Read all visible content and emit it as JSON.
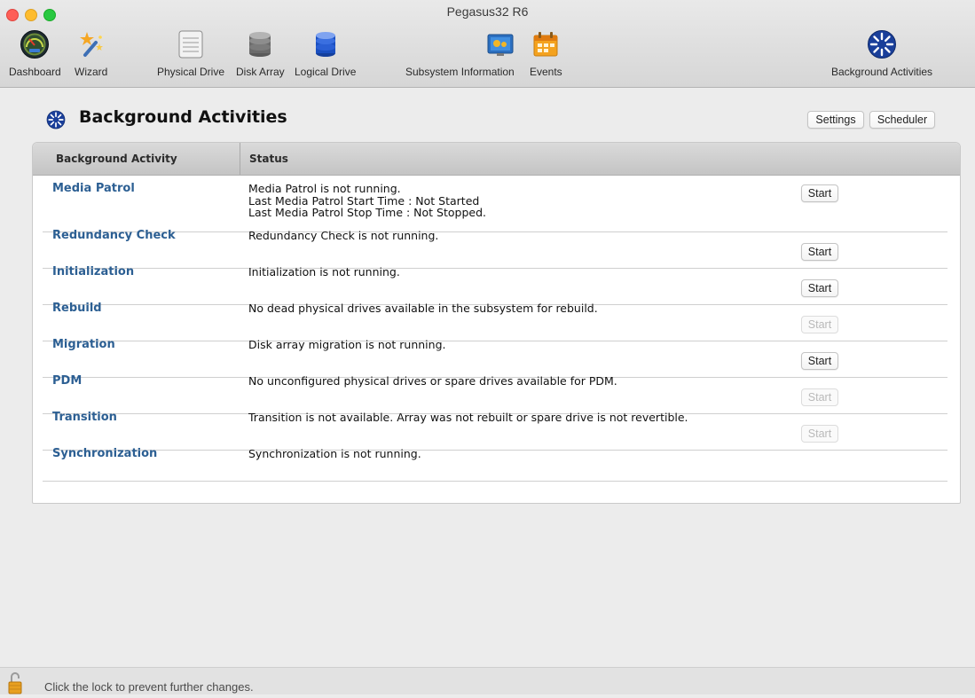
{
  "window": {
    "title": "Pegasus32 R6"
  },
  "toolbar": {
    "items": [
      {
        "label": "Dashboard",
        "icon": "dashboard-gauge-icon"
      },
      {
        "label": "Wizard",
        "icon": "wizard-wand-icon"
      },
      {
        "label": "Physical Drive",
        "icon": "physical-drive-icon"
      },
      {
        "label": "Disk Array",
        "icon": "disk-array-icon"
      },
      {
        "label": "Logical Drive",
        "icon": "logical-drive-icon"
      },
      {
        "label": "Subsystem Information",
        "icon": "subsystem-information-icon"
      },
      {
        "label": "Events",
        "icon": "events-calendar-icon"
      },
      {
        "label": "Background Activities",
        "icon": "background-activities-icon"
      }
    ]
  },
  "main": {
    "title": "Background Activities",
    "settings_label": "Settings",
    "scheduler_label": "Scheduler",
    "columns": [
      "Background Activity",
      "Status"
    ],
    "activities": [
      {
        "name": "Media Patrol",
        "status": [
          "Media Patrol is not running.",
          "Last Media Patrol Start Time : Not Started",
          "Last Media Patrol Stop Time : Not Stopped."
        ],
        "button": "Start",
        "enabled": true
      },
      {
        "name": "Redundancy Check",
        "status": [
          "Redundancy Check is not running."
        ],
        "button": "Start",
        "enabled": true
      },
      {
        "name": "Initialization",
        "status": [
          "Initialization is not running."
        ],
        "button": "Start",
        "enabled": true
      },
      {
        "name": "Rebuild",
        "status": [
          "No dead physical drives available in the subsystem for rebuild."
        ],
        "button": "Start",
        "enabled": false
      },
      {
        "name": "Migration",
        "status": [
          "Disk array migration is not running."
        ],
        "button": "Start",
        "enabled": true
      },
      {
        "name": "PDM",
        "status": [
          "No unconfigured physical drives or spare drives available for PDM."
        ],
        "button": "Start",
        "enabled": false
      },
      {
        "name": "Transition",
        "status": [
          "Transition is not available. Array was not rebuilt or spare drive is not revertible."
        ],
        "button": "Start",
        "enabled": false
      },
      {
        "name": "Synchronization",
        "status": [
          "Synchronization is not running."
        ],
        "button": null,
        "enabled": false
      }
    ]
  },
  "footer": {
    "text": "Click the lock to prevent further changes."
  },
  "colors": {
    "link": "#2c5f93",
    "window_bg": "#ececec"
  }
}
